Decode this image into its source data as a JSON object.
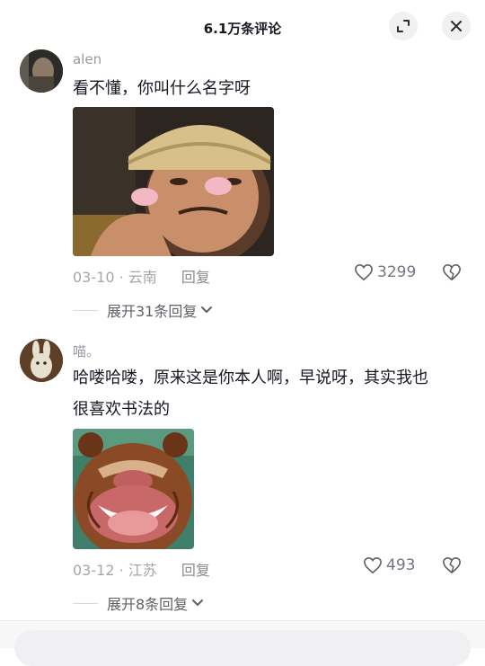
{
  "header": {
    "title": "6.1万条评论",
    "expand_icon": "expand-icon",
    "close_icon": "close-icon"
  },
  "comments": [
    {
      "username": "alen",
      "text": "看不懂，你叫什么名字呀",
      "date": "03-10",
      "location": "云南",
      "reply_label": "回复",
      "likes": "3299",
      "expand_label": "展开31条回复"
    },
    {
      "username": "喵。",
      "text_line1": "哈喽哈喽，原来这是你本人啊，早说呀，其实我也",
      "text_line2": "很喜欢书法的",
      "date": "03-12",
      "location": "江苏",
      "reply_label": "回复",
      "likes": "493",
      "expand_label": "展开8条回复"
    }
  ]
}
